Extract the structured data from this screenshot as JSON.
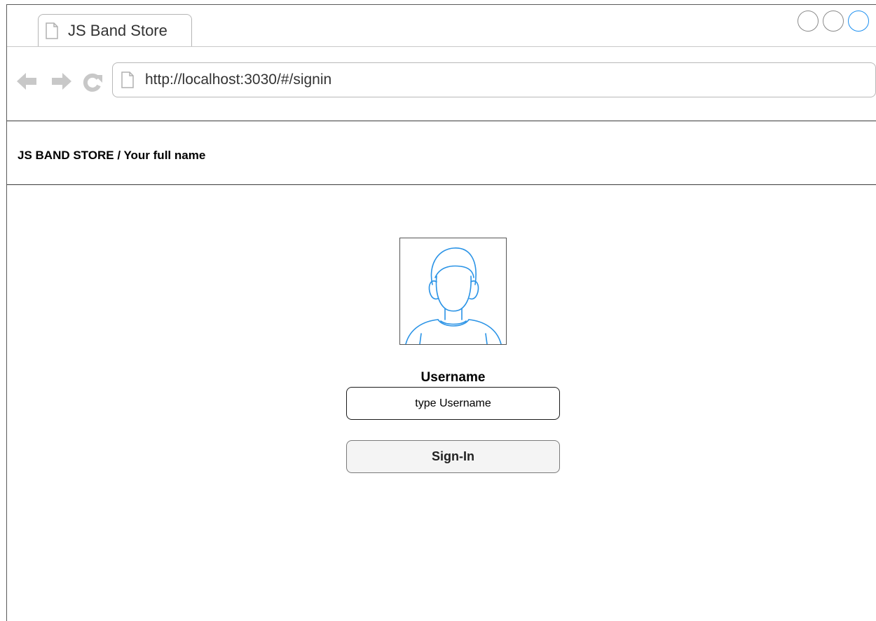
{
  "browser": {
    "tab": {
      "title": "JS Band Store",
      "icon": "document-icon"
    },
    "window_buttons": [
      "circle",
      "circle",
      "circle-active"
    ],
    "nav": {
      "back_icon": "back-arrow-icon",
      "forward_icon": "forward-arrow-icon",
      "reload_icon": "reload-icon"
    },
    "url": "http://localhost:3030/#/signin"
  },
  "app": {
    "header_title": "JS BAND STORE / Your full name"
  },
  "signin": {
    "avatar_icon": "user-avatar-icon",
    "username_label": "Username",
    "username_placeholder": "type Username",
    "username_value": "",
    "submit_label": "Sign-In"
  },
  "colors": {
    "accent": "#1e90f0",
    "border": "#1a1a1a",
    "muted_icon": "#c8c8c8",
    "button_bg": "#f4f4f4"
  }
}
